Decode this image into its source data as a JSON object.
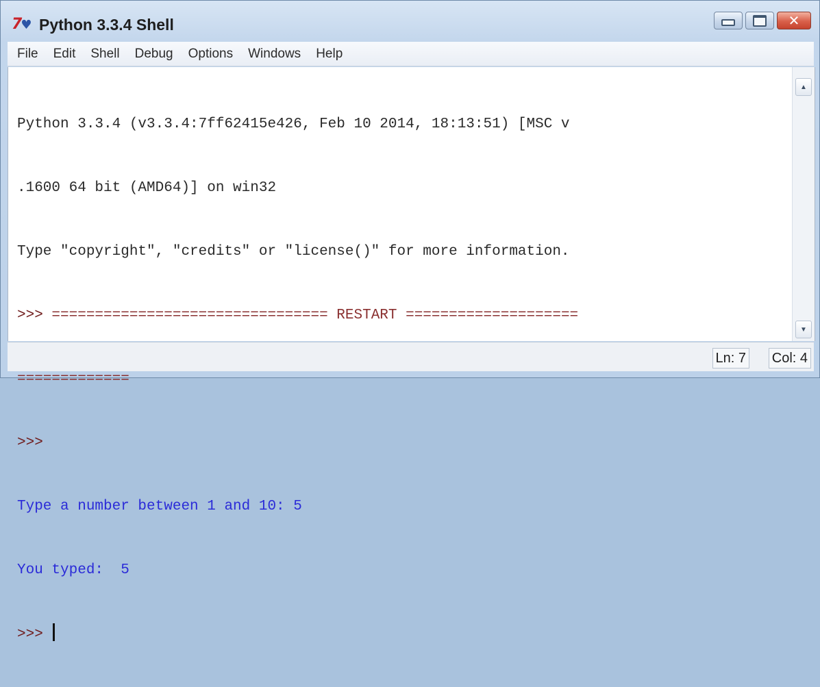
{
  "window": {
    "title": "Python 3.3.4 Shell",
    "app_icon_main": "7",
    "app_icon_snake": "♥"
  },
  "window_buttons": {
    "close_glyph": "✕"
  },
  "menu": [
    "File",
    "Edit",
    "Shell",
    "Debug",
    "Options",
    "Windows",
    "Help"
  ],
  "shell": {
    "lines": [
      "Python 3.3.4 (v3.3.4:7ff62415e426, Feb 10 2014, 18:13:51) [MSC v",
      ".1600 64 bit (AMD64)] on win32",
      "Type \"copyright\", \"credits\" or \"license()\" for more information."
    ],
    "restart_prompt": ">>> ",
    "restart_line": "================================ RESTART ====================",
    "restart_line_cont": "=============",
    "prompt_1": ">>>",
    "input_line": "Type a number between 1 and 10: 5",
    "output_line": "You typed:  5",
    "prompt_2": ">>> "
  },
  "scroll": {
    "up_glyph": "▲",
    "down_glyph": "▼"
  },
  "status": {
    "ln": "Ln: 7",
    "col": "Col: 4"
  },
  "colors": {
    "stdout": "#2b2bd8",
    "restart": "#8a3030",
    "prompt": "#6f1a1a"
  }
}
